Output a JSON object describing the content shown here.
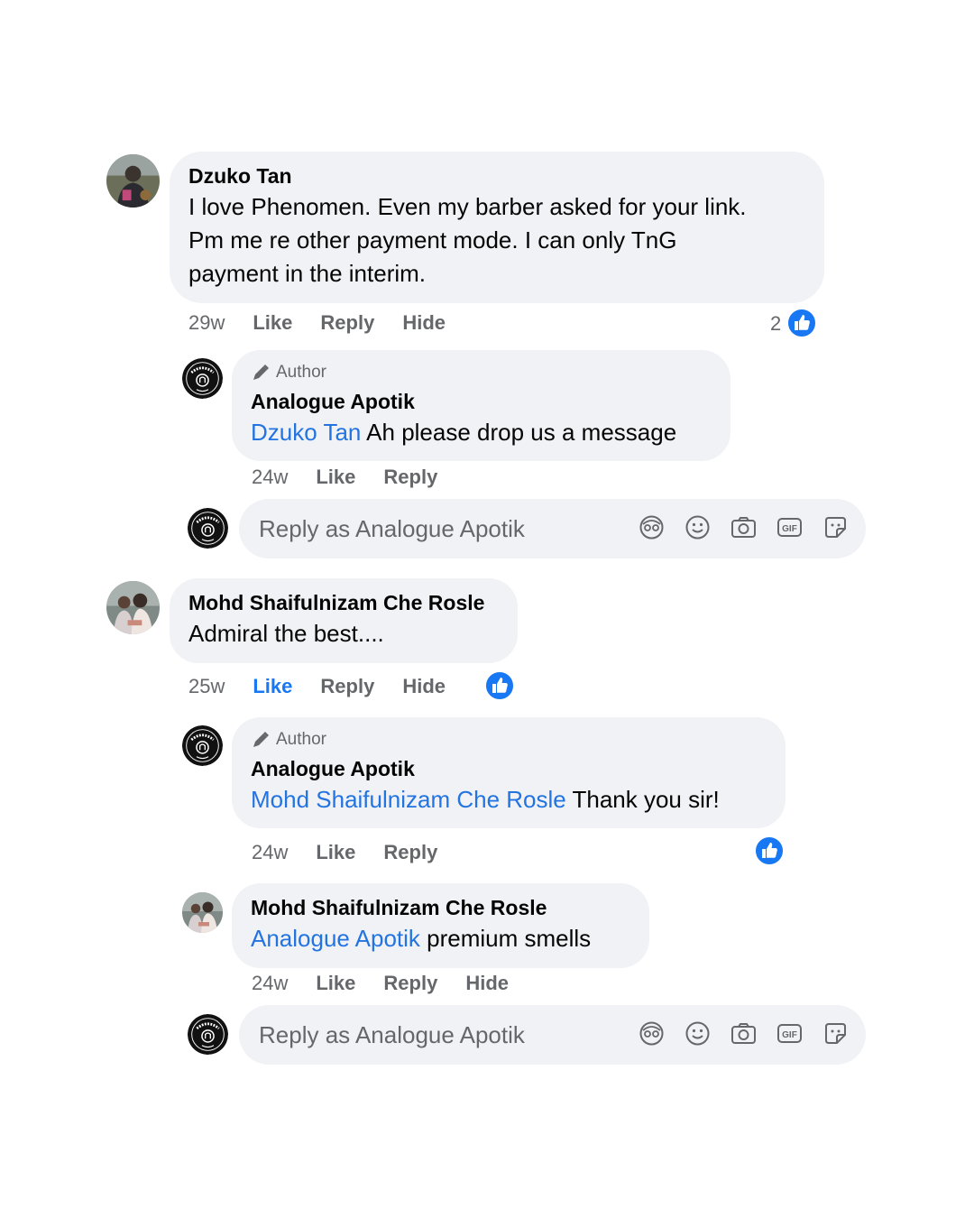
{
  "colors": {
    "bubble": "#f0f2f5",
    "link": "#2374e1",
    "like_blue": "#1877f2",
    "muted": "#65676b"
  },
  "comments": [
    {
      "author": "Dzuko Tan",
      "lines": [
        "I love Phenomen. Even my barber asked for your link.",
        "Pm me re other payment mode. I can only TnG",
        "payment in the interim."
      ],
      "time": "29w",
      "like": "Like",
      "reply": "Reply",
      "hide": "Hide",
      "reaction_count": "2",
      "replies": [
        {
          "badge": "Author",
          "author": "Analogue Apotik",
          "mention": "Dzuko Tan",
          "text": " Ah please drop us a message",
          "time": "24w",
          "like": "Like",
          "reply": "Reply"
        }
      ],
      "reply_placeholder": "Reply as Analogue Apotik"
    },
    {
      "author": "Mohd Shaifulnizam Che Rosle",
      "lines": [
        "Admiral the best...."
      ],
      "time": "25w",
      "like": "Like",
      "reply": "Reply",
      "hide": "Hide",
      "replies": [
        {
          "badge": "Author",
          "author": "Analogue Apotik",
          "mention": "Mohd Shaifulnizam Che Rosle",
          "text": " Thank you sir!",
          "time": "24w",
          "like": "Like",
          "reply": "Reply"
        },
        {
          "author": "Mohd Shaifulnizam Che Rosle",
          "mention": "Analogue Apotik",
          "text": " premium smells",
          "time": "24w",
          "like": "Like",
          "reply": "Reply",
          "hide": "Hide"
        }
      ],
      "reply_placeholder": "Reply as Analogue Apotik"
    }
  ],
  "icons": [
    "avatar-sticker-icon",
    "emoji-icon",
    "camera-icon",
    "gif-icon",
    "sticker-icon"
  ]
}
